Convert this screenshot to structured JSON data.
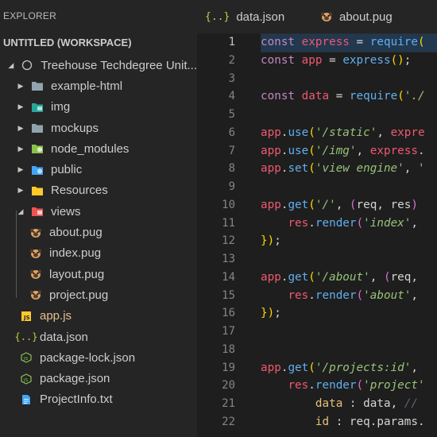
{
  "sidebar": {
    "title": "EXPLORER",
    "workspace": "UNTITLED (WORKSPACE)",
    "items": [
      {
        "label": "Treehouse Techdegree Unit...",
        "chev": "◢",
        "indent": 8,
        "icon": "ring"
      },
      {
        "label": "example-html",
        "chev": "▶",
        "indent": 20,
        "icon": "folder"
      },
      {
        "label": "img",
        "chev": "▶",
        "indent": 20,
        "icon": "img-folder"
      },
      {
        "label": "mockups",
        "chev": "▶",
        "indent": 20,
        "icon": "folder"
      },
      {
        "label": "node_modules",
        "chev": "▶",
        "indent": 20,
        "icon": "node-folder"
      },
      {
        "label": "public",
        "chev": "▶",
        "indent": 20,
        "icon": "globe-folder"
      },
      {
        "label": "Resources",
        "chev": "▶",
        "indent": 20,
        "icon": "yellow-folder"
      },
      {
        "label": "views",
        "chev": "◢",
        "indent": 20,
        "icon": "views-folder"
      },
      {
        "label": "about.pug",
        "chev": "",
        "indent": 36,
        "icon": "pug"
      },
      {
        "label": "index.pug",
        "chev": "",
        "indent": 36,
        "icon": "pug"
      },
      {
        "label": "layout.pug",
        "chev": "",
        "indent": 36,
        "icon": "pug"
      },
      {
        "label": "project.pug",
        "chev": "",
        "indent": 36,
        "icon": "pug"
      },
      {
        "label": "app.js",
        "chev": "",
        "indent": 24,
        "icon": "js"
      },
      {
        "label": "data.json",
        "chev": "",
        "indent": 24,
        "icon": "json"
      },
      {
        "label": "package-lock.json",
        "chev": "",
        "indent": 24,
        "icon": "npm"
      },
      {
        "label": "package.json",
        "chev": "",
        "indent": 24,
        "icon": "npm"
      },
      {
        "label": "ProjectInfo.txt",
        "chev": "",
        "indent": 24,
        "icon": "txt"
      }
    ]
  },
  "tabs": [
    {
      "label": "data.json",
      "icon": "{..}"
    },
    {
      "label": "about.pug",
      "icon": "pug"
    }
  ],
  "editor": {
    "line_numbers": [
      "1",
      "2",
      "3",
      "4",
      "5",
      "6",
      "7",
      "8",
      "9",
      "10",
      "11",
      "12",
      "13",
      "14",
      "15",
      "16",
      "17",
      "18",
      "19",
      "20",
      "21",
      "22"
    ],
    "lines": [
      [
        [
          "kw",
          "const "
        ],
        [
          "var",
          "express"
        ],
        [
          "plain",
          " = "
        ],
        [
          "fn",
          "require"
        ],
        [
          "brk",
          "("
        ]
      ],
      [
        [
          "kw",
          "const "
        ],
        [
          "var",
          "app"
        ],
        [
          "plain",
          " = "
        ],
        [
          "fn",
          "express"
        ],
        [
          "brk",
          "()"
        ],
        [
          "plain",
          ";"
        ]
      ],
      [],
      [
        [
          "kw",
          "const "
        ],
        [
          "var",
          "data"
        ],
        [
          "plain",
          " = "
        ],
        [
          "fn",
          "require"
        ],
        [
          "brk",
          "("
        ],
        [
          "str",
          "'./"
        ]
      ],
      [],
      [
        [
          "var",
          "app"
        ],
        [
          "plain",
          "."
        ],
        [
          "fn",
          "use"
        ],
        [
          "brk",
          "("
        ],
        [
          "str",
          "'/static'"
        ],
        [
          "plain",
          ", "
        ],
        [
          "var",
          "expre"
        ]
      ],
      [
        [
          "var",
          "app"
        ],
        [
          "plain",
          "."
        ],
        [
          "fn",
          "use"
        ],
        [
          "brk",
          "("
        ],
        [
          "str",
          "'/img'"
        ],
        [
          "plain",
          ", "
        ],
        [
          "var",
          "express"
        ],
        [
          "plain",
          "."
        ]
      ],
      [
        [
          "var",
          "app"
        ],
        [
          "plain",
          "."
        ],
        [
          "fn",
          "set"
        ],
        [
          "brk",
          "("
        ],
        [
          "str",
          "'view engine'"
        ],
        [
          "plain",
          ", "
        ],
        [
          "str",
          "'"
        ]
      ],
      [],
      [
        [
          "var",
          "app"
        ],
        [
          "plain",
          "."
        ],
        [
          "fn",
          "get"
        ],
        [
          "brk",
          "("
        ],
        [
          "str",
          "'/'"
        ],
        [
          "plain",
          ", "
        ],
        [
          "brk2",
          "("
        ],
        [
          "plain",
          "req, res"
        ],
        [
          "brk2",
          ")"
        ]
      ],
      [
        [
          "plain",
          "    "
        ],
        [
          "var",
          "res"
        ],
        [
          "plain",
          "."
        ],
        [
          "fn",
          "render"
        ],
        [
          "brk2",
          "("
        ],
        [
          "str",
          "'index'"
        ],
        [
          "plain",
          ", "
        ]
      ],
      [
        [
          "brk",
          "}"
        ],
        [
          "brk",
          ")"
        ],
        [
          "plain",
          ";"
        ]
      ],
      [],
      [
        [
          "var",
          "app"
        ],
        [
          "plain",
          "."
        ],
        [
          "fn",
          "get"
        ],
        [
          "brk",
          "("
        ],
        [
          "str",
          "'/about'"
        ],
        [
          "plain",
          ", "
        ],
        [
          "brk2",
          "("
        ],
        [
          "plain",
          "req, "
        ]
      ],
      [
        [
          "plain",
          "    "
        ],
        [
          "var",
          "res"
        ],
        [
          "plain",
          "."
        ],
        [
          "fn",
          "render"
        ],
        [
          "brk2",
          "("
        ],
        [
          "str",
          "'about'"
        ],
        [
          "plain",
          ", "
        ]
      ],
      [
        [
          "brk",
          "}"
        ],
        [
          "brk",
          ")"
        ],
        [
          "plain",
          ";"
        ]
      ],
      [],
      [],
      [
        [
          "var",
          "app"
        ],
        [
          "plain",
          "."
        ],
        [
          "fn",
          "get"
        ],
        [
          "brk",
          "("
        ],
        [
          "str",
          "'/projects:id'"
        ],
        [
          "plain",
          ", "
        ]
      ],
      [
        [
          "plain",
          "    "
        ],
        [
          "var",
          "res"
        ],
        [
          "plain",
          "."
        ],
        [
          "fn",
          "render"
        ],
        [
          "brk2",
          "("
        ],
        [
          "str",
          "'project'"
        ]
      ],
      [
        [
          "plain",
          "        "
        ],
        [
          "obj",
          "data"
        ],
        [
          "plain",
          " : data, "
        ],
        [
          "com",
          "// "
        ]
      ],
      [
        [
          "plain",
          "        "
        ],
        [
          "obj",
          "id"
        ],
        [
          "plain",
          " : req.params."
        ]
      ]
    ]
  }
}
